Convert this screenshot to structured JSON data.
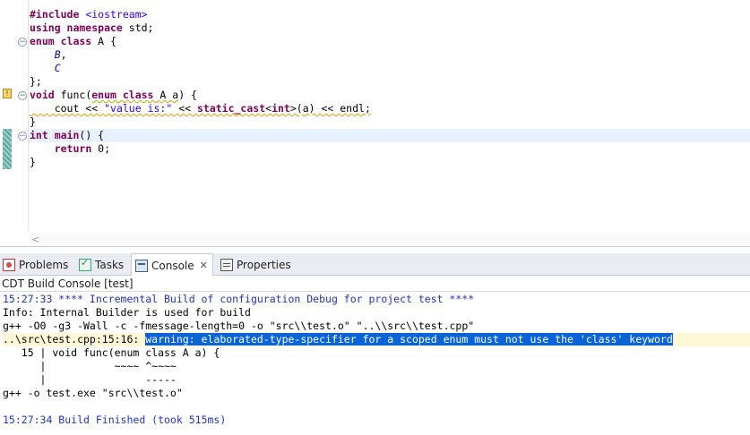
{
  "editor": {
    "lines": [
      {
        "parts": [
          {
            "t": "#include ",
            "c": "pp"
          },
          {
            "t": "<iostream>",
            "c": "inc"
          }
        ]
      },
      {
        "parts": [
          {
            "t": "using namespace ",
            "c": "kw"
          },
          {
            "t": "std;",
            "c": ""
          }
        ]
      },
      {
        "parts": [
          {
            "t": "enum class ",
            "c": "kw"
          },
          {
            "t": "A {",
            "c": ""
          }
        ]
      },
      {
        "parts": [
          {
            "t": "    ",
            "c": ""
          },
          {
            "t": "B",
            "c": "enumc"
          },
          {
            "t": ",",
            "c": ""
          }
        ]
      },
      {
        "parts": [
          {
            "t": "    ",
            "c": ""
          },
          {
            "t": "C",
            "c": "enumc"
          }
        ]
      },
      {
        "parts": [
          {
            "t": "};",
            "c": ""
          }
        ]
      },
      {
        "parts": [
          {
            "t": "void ",
            "c": "kw"
          },
          {
            "t": "func(",
            "c": ""
          },
          {
            "t": "enum class ",
            "c": "kw wavy"
          },
          {
            "t": "A a",
            "c": "wavy"
          },
          {
            "t": ") {",
            "c": ""
          }
        ]
      },
      {
        "parts": [
          {
            "t": "    cout << ",
            "c": "wavy"
          },
          {
            "t": "\"value is:\"",
            "c": "str wavy"
          },
          {
            "t": " << ",
            "c": "wavy"
          },
          {
            "t": "static_cast",
            "c": "kw wavy"
          },
          {
            "t": "<",
            "c": "wavy"
          },
          {
            "t": "int",
            "c": "kw wavy"
          },
          {
            "t": ">(a) << endl;",
            "c": "wavy"
          }
        ]
      },
      {
        "parts": [
          {
            "t": "}",
            "c": ""
          }
        ]
      },
      {
        "parts": [
          {
            "t": "int ",
            "c": "kw"
          },
          {
            "t": "main",
            "c": "kw"
          },
          {
            "t": "() {",
            "c": ""
          }
        ],
        "current": true
      },
      {
        "parts": [
          {
            "t": "    ",
            "c": ""
          },
          {
            "t": "return ",
            "c": "kw"
          },
          {
            "t": "0;",
            "c": ""
          }
        ]
      },
      {
        "parts": [
          {
            "t": "}",
            "c": ""
          }
        ]
      }
    ],
    "scroll_arrow": "<"
  },
  "tabs": {
    "problems": "Problems",
    "tasks": "Tasks",
    "console": "Console",
    "console_close": "✕",
    "properties": "Properties"
  },
  "console": {
    "title": "CDT Build Console [test]",
    "line1": "15:27:33 **** Incremental Build of configuration Debug for project test ****",
    "line2": "Info: Internal Builder is used for build",
    "line3": "g++ -O0 -g3 -Wall -c -fmessage-length=0 -o \"src\\\\test.o\" \"..\\\\src\\\\test.cpp\"",
    "line4_prefix": "..\\src\\test.cpp:15:16: ",
    "line4_selected": "warning: elaborated-type-specifier for a scoped enum must not use the 'class' keyword",
    "line5": "   15 | void func(enum class A a) {",
    "line6": "      |           ~~~~ ^~~~~",
    "line7": "      |                -----",
    "line8": "g++ -o test.exe \"src\\\\test.o\"",
    "line9": "15:27:34 Build Finished (took 515ms)"
  },
  "colors": {
    "keyword": "#7f0055",
    "string": "#2a00ff",
    "console_blue": "#1f33c9",
    "selection": "#0a64d8"
  }
}
